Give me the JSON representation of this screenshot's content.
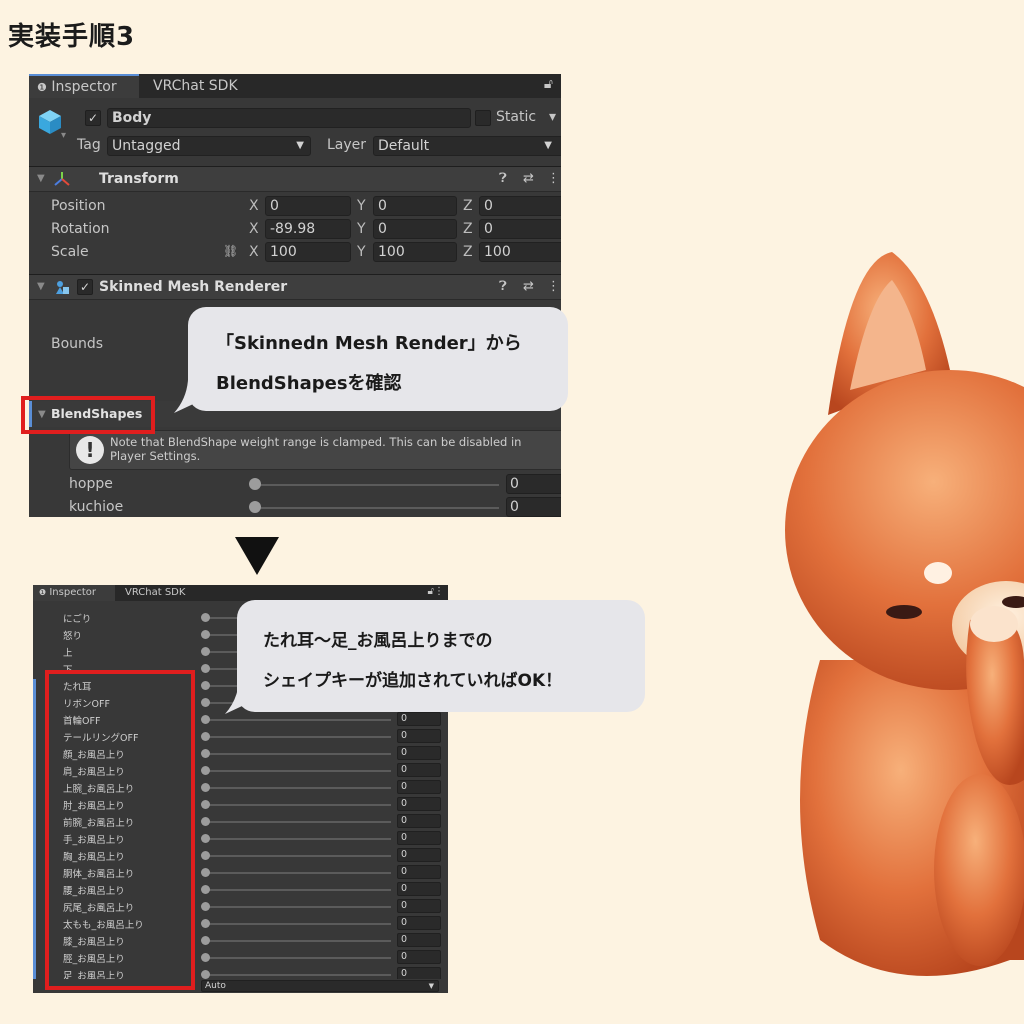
{
  "page_title": "実装手順3",
  "inspector_top": {
    "tabs": [
      "Inspector",
      "VRChat SDK"
    ],
    "object_name": "Body",
    "static_label": "Static",
    "tag_label": "Tag",
    "tag_value": "Untagged",
    "layer_label": "Layer",
    "layer_value": "Default",
    "transform": {
      "title": "Transform",
      "position_label": "Position",
      "rotation_label": "Rotation",
      "scale_label": "Scale",
      "position": {
        "x": "0",
        "y": "0",
        "z": "0"
      },
      "rotation": {
        "x": "-89.98",
        "y": "0",
        "z": "0"
      },
      "scale": {
        "x": "100",
        "y": "100",
        "z": "100"
      }
    },
    "smr": {
      "title": "Skinned Mesh Renderer",
      "bounds_label": "Bounds",
      "blendshapes_label": "BlendShapes",
      "note": "Note that BlendShape weight range is clamped. This can be disabled in Player Settings.",
      "rows": [
        {
          "label": "hoppe",
          "value": "0"
        },
        {
          "label": "kuchioe",
          "value": "0"
        }
      ]
    }
  },
  "bubble_top": {
    "line1": "「Skinnedn Mesh Render」から",
    "line2": "BlendShapesを確認"
  },
  "inspector_bottom": {
    "tabs": [
      "Inspector",
      "VRChat SDK"
    ],
    "rows": [
      {
        "label": "にごり",
        "value": ""
      },
      {
        "label": "怒り",
        "value": ""
      },
      {
        "label": "上",
        "value": ""
      },
      {
        "label": "下",
        "value": ""
      },
      {
        "label": "たれ耳",
        "value": ""
      },
      {
        "label": "リボンOFF",
        "value": ""
      },
      {
        "label": "首輪OFF",
        "value": "0"
      },
      {
        "label": "テールリングOFF",
        "value": "0"
      },
      {
        "label": "顔_お風呂上り",
        "value": "0"
      },
      {
        "label": "肩_お風呂上り",
        "value": "0"
      },
      {
        "label": "上腕_お風呂上り",
        "value": "0"
      },
      {
        "label": "肘_お風呂上り",
        "value": "0"
      },
      {
        "label": "前腕_お風呂上り",
        "value": "0"
      },
      {
        "label": "手_お風呂上り",
        "value": "0"
      },
      {
        "label": "胸_お風呂上り",
        "value": "0"
      },
      {
        "label": "胴体_お風呂上り",
        "value": "0"
      },
      {
        "label": "腰_お風呂上り",
        "value": "0"
      },
      {
        "label": "尻尾_お風呂上り",
        "value": "0"
      },
      {
        "label": "太もも_お風呂上り",
        "value": "0"
      },
      {
        "label": "膝_お風呂上り",
        "value": "0"
      },
      {
        "label": "脛_お風呂上り",
        "value": "0"
      },
      {
        "label": "足_お風呂上り",
        "value": "0"
      }
    ],
    "footer_value": "Auto"
  },
  "bubble_bottom": {
    "line1": "たれ耳～足_お風呂上りまでの",
    "line2": "シェイプキーが追加されていればOK！"
  },
  "colors": {
    "background": "#fdf3e1",
    "highlight_red": "#e01e1e",
    "panel": "#383838"
  }
}
